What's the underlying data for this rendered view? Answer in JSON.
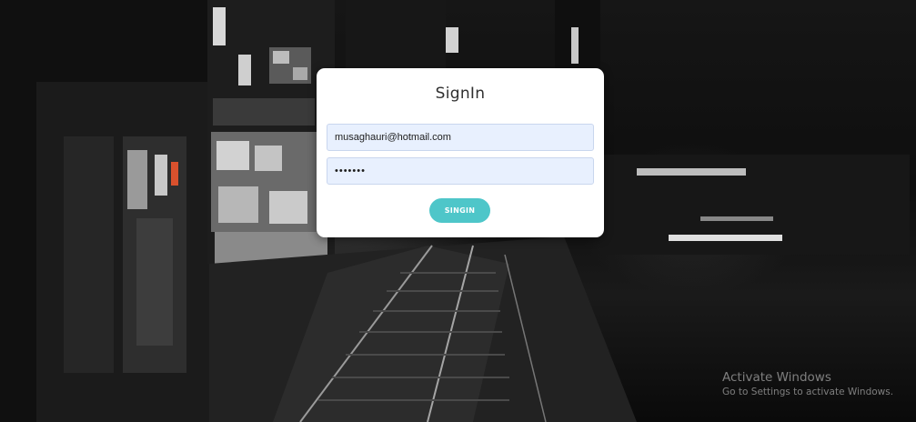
{
  "signin": {
    "title": "SignIn",
    "email_value": "musaghauri@hotmail.com",
    "password_value": "•••••••",
    "button_label": "SINGIN"
  },
  "watermark": {
    "title": "Activate Windows",
    "subtitle": "Go to Settings to activate Windows."
  },
  "colors": {
    "button": "#4ec6c9",
    "input_fill": "#e8f0fe",
    "card": "#ffffff"
  },
  "icons": [
    "city-night-background"
  ]
}
